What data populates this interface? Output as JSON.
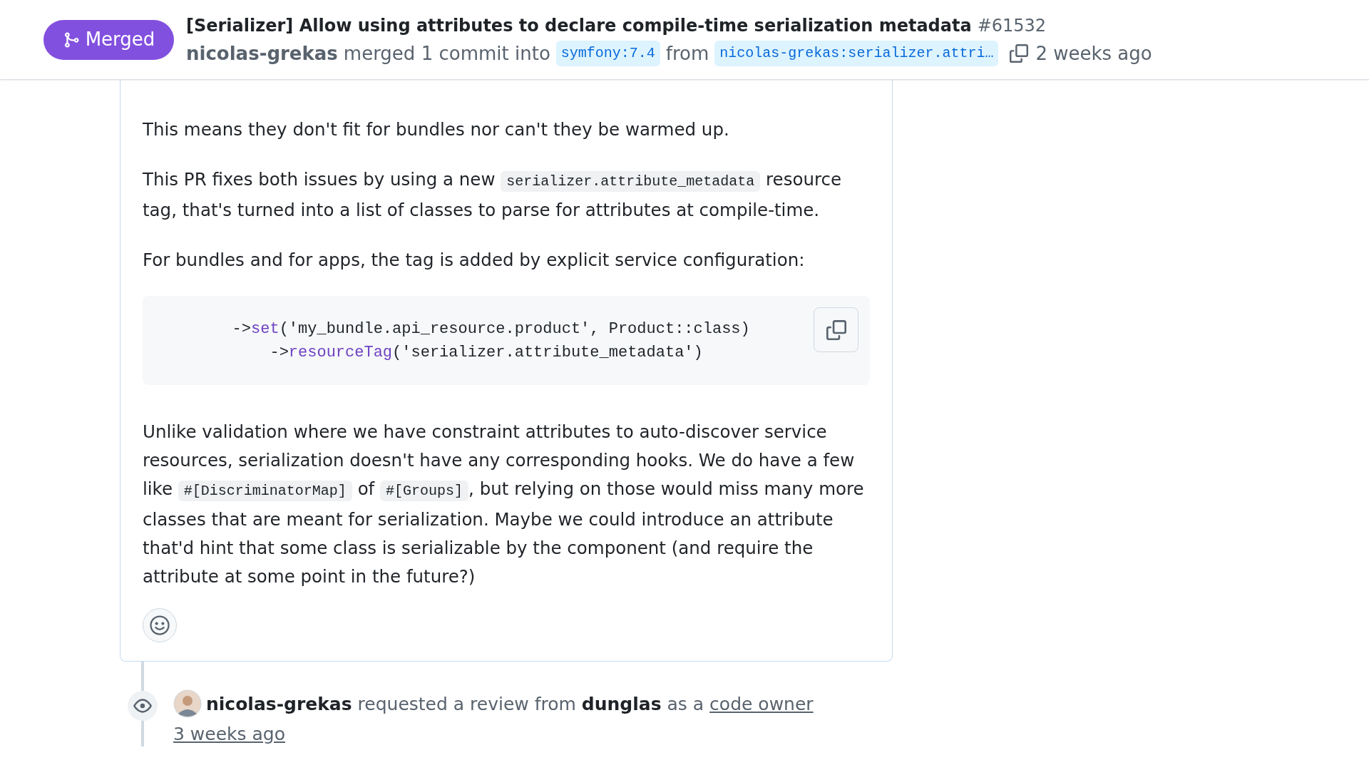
{
  "header": {
    "status": {
      "label": "Merged"
    },
    "title": "[Serializer] Allow using attributes to declare compile-time serialization metadata",
    "number": "#61532",
    "author": "nicolas-grekas",
    "action": "merged 1 commit into",
    "base_branch": "symfony:7.4",
    "from_word": "from",
    "head_branch": "nicolas-grekas:serializer.attri…",
    "time": "2 weeks ago"
  },
  "comment": {
    "blocks": [
      {
        "kind": "paragraph",
        "segments": [
          {
            "kind": "text",
            "text": "This means they don't fit for bundles nor can't they be warmed up."
          }
        ]
      },
      {
        "kind": "paragraph",
        "segments": [
          {
            "kind": "text",
            "text": "This PR fixes both issues by using a new "
          },
          {
            "kind": "code",
            "text": "serializer.attribute_metadata"
          },
          {
            "kind": "text",
            "text": " resource tag, that's turned into a list of classes to parse for attributes at compile-time."
          }
        ]
      },
      {
        "kind": "paragraph",
        "segments": [
          {
            "kind": "text",
            "text": "For bundles and for apps, the tag is added by explicit service configuration:"
          }
        ]
      },
      {
        "kind": "code",
        "lines": [
          [
            {
              "kind": "plain",
              "text": "        ->"
            },
            {
              "kind": "method",
              "text": "set"
            },
            {
              "kind": "plain",
              "text": "('my_bundle.api_resource.product', Product::class)"
            }
          ],
          [
            {
              "kind": "plain",
              "text": "            ->"
            },
            {
              "kind": "method",
              "text": "resourceTag"
            },
            {
              "kind": "plain",
              "text": "('serializer.attribute_metadata')"
            }
          ]
        ]
      },
      {
        "kind": "paragraph",
        "segments": [
          {
            "kind": "text",
            "text": "Unlike validation where we have constraint attributes to auto-discover service resources, serialization doesn't have any corresponding hooks. We do have a few like "
          },
          {
            "kind": "code",
            "text": "#[DiscriminatorMap]"
          },
          {
            "kind": "text",
            "text": " of "
          },
          {
            "kind": "code",
            "text": "#[Groups]"
          },
          {
            "kind": "text",
            "text": ", but relying on those would miss many more classes that are meant for serialization. Maybe we could introduce an attribute that'd hint that some class is serializable by the component (and require the attribute at some point in the future?)"
          }
        ]
      }
    ]
  },
  "timeline_event": {
    "actor": "nicolas-grekas",
    "text_1": "requested a review from",
    "reviewer": "dunglas",
    "text_2": "as a",
    "link": "code owner",
    "time": "3 weeks ago"
  }
}
